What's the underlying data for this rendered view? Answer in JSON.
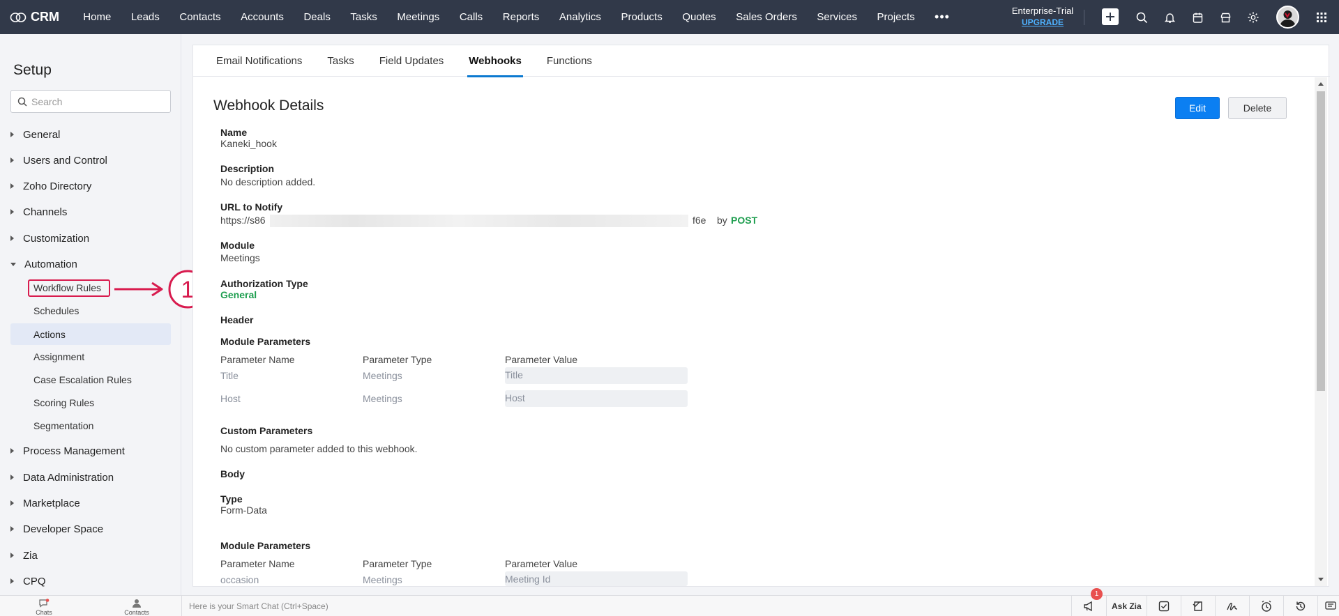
{
  "topnav": {
    "logo_text": "CRM",
    "items": [
      "Home",
      "Leads",
      "Contacts",
      "Accounts",
      "Deals",
      "Tasks",
      "Meetings",
      "Calls",
      "Reports",
      "Analytics",
      "Products",
      "Quotes",
      "Sales Orders",
      "Services",
      "Projects"
    ],
    "more": "•••",
    "plan": "Enterprise-Trial",
    "upgrade": "UPGRADE",
    "icons": [
      "plus-icon",
      "search-icon",
      "bell-icon",
      "calendar-icon",
      "marketplace-icon",
      "gear-icon",
      "avatar",
      "apps-grid-icon"
    ]
  },
  "sidebar": {
    "title": "Setup",
    "search_placeholder": "Search",
    "groups": [
      {
        "label": "General"
      },
      {
        "label": "Users and Control"
      },
      {
        "label": "Zoho Directory"
      },
      {
        "label": "Channels"
      },
      {
        "label": "Customization"
      },
      {
        "label": "Automation"
      }
    ],
    "automation_items": [
      "Workflow Rules",
      "Schedules",
      "Actions",
      "Assignment",
      "Case Escalation Rules",
      "Scoring Rules",
      "Segmentation"
    ],
    "groups_after": [
      "Process Management",
      "Data Administration",
      "Marketplace",
      "Developer Space",
      "Zia",
      "CPQ"
    ],
    "annotation_number": "1"
  },
  "tabs": [
    "Email Notifications",
    "Tasks",
    "Field Updates",
    "Webhooks",
    "Functions"
  ],
  "active_tab": "Webhooks",
  "details": {
    "title": "Webhook Details",
    "edit": "Edit",
    "delete": "Delete",
    "name_label": "Name",
    "name_value": "Kaneki_hook",
    "desc_label": "Description",
    "desc_value": "No description added.",
    "url_label": "URL to Notify",
    "url_prefix": "https://s86",
    "url_suffix": "f6e",
    "url_by": "by",
    "url_method": "POST",
    "module_label": "Module",
    "module_value": "Meetings",
    "auth_label": "Authorization Type",
    "auth_value": "General",
    "header_label": "Header",
    "module_params_label": "Module Parameters",
    "param_headers": [
      "Parameter Name",
      "Parameter Type",
      "Parameter Value"
    ],
    "module_params": [
      {
        "name": "Title",
        "type": "Meetings",
        "value": "Title"
      },
      {
        "name": "Host",
        "type": "Meetings",
        "value": "Host"
      }
    ],
    "custom_params_label": "Custom Parameters",
    "custom_params_value": "No custom parameter added to this webhook.",
    "body_label": "Body",
    "type_label": "Type",
    "type_value": "Form-Data",
    "body_module_params_label": "Module Parameters",
    "body_params": [
      {
        "name": "occasion",
        "type": "Meetings",
        "value": "Meeting Id"
      }
    ]
  },
  "bottombar": {
    "chats": "Chats",
    "contacts": "Contacts",
    "smart_chat": "Here is your Smart Chat (Ctrl+Space)",
    "badge": "1",
    "ask_zia": "Ask Zia"
  }
}
